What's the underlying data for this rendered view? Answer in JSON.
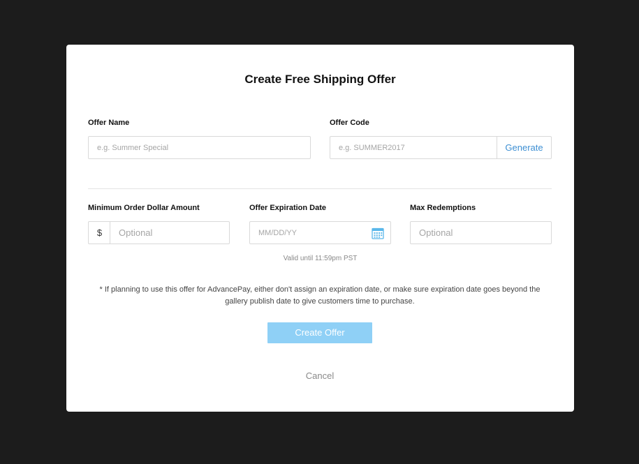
{
  "modal": {
    "title": "Create Free Shipping Offer"
  },
  "offer_name": {
    "label": "Offer Name",
    "placeholder": "e.g. Summer Special",
    "value": ""
  },
  "offer_code": {
    "label": "Offer Code",
    "placeholder": "e.g. SUMMER2017",
    "value": "",
    "generate_label": "Generate"
  },
  "min_order": {
    "label": "Minimum Order Dollar Amount",
    "prefix": "$",
    "placeholder": "Optional",
    "value": ""
  },
  "expiration": {
    "label": "Offer Expiration Date",
    "placeholder": "MM/DD/YY",
    "value": "",
    "icon": "calendar-icon",
    "hint": "Valid until 11:59pm PST"
  },
  "max_redemptions": {
    "label": "Max Redemptions",
    "placeholder": "Optional",
    "value": ""
  },
  "note": "* If planning to use this offer for AdvancePay, either don't assign an expiration date, or make sure expiration date goes beyond the gallery publish date to give customers time to purchase.",
  "actions": {
    "create_label": "Create Offer",
    "cancel_label": "Cancel"
  },
  "colors": {
    "backdrop": "#1c1c1c",
    "accent": "#3d8fd3",
    "create_button": "#8fd0f6",
    "calendar_icon": "#5ab7ea"
  }
}
